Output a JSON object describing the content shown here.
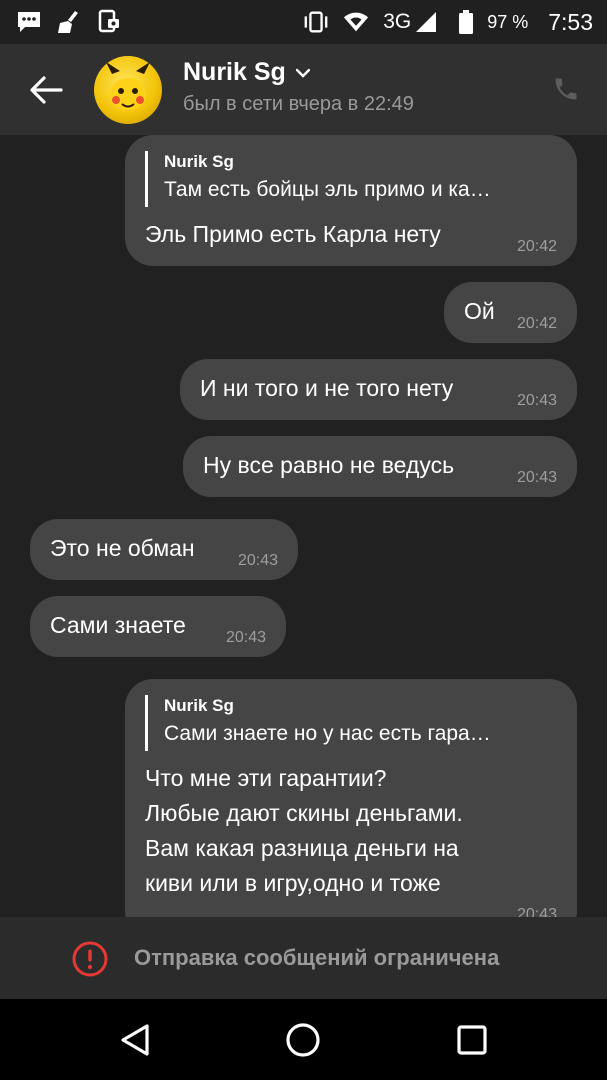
{
  "status_bar": {
    "network": "3G",
    "battery": "97 %",
    "time": "7:53",
    "icons": [
      "message-notification-icon",
      "cleaner-icon",
      "screenshot-icon",
      "vibrate-icon",
      "wifi-icon",
      "signal-icon",
      "battery-icon"
    ]
  },
  "header": {
    "contact_name": "Nurik Sg",
    "last_seen": "был в сети вчера в 22:49"
  },
  "messages": [
    {
      "direction": "outgoing",
      "quote_author": "Nurik Sg",
      "quote_text": "Там есть бойцы эль примо и ка…",
      "text": "Эль Примо есть Карла нету",
      "time": "20:42"
    },
    {
      "direction": "outgoing",
      "text": "Ой",
      "time": "20:42"
    },
    {
      "direction": "outgoing",
      "text": "И ни того и не того нету",
      "time": "20:43"
    },
    {
      "direction": "outgoing",
      "text": "Ну все равно не ведусь",
      "time": "20:43"
    },
    {
      "direction": "incoming",
      "text": "Это не обман",
      "time": "20:43"
    },
    {
      "direction": "incoming",
      "text": "Сами знаете",
      "time": "20:43"
    },
    {
      "direction": "outgoing",
      "quote_author": "Nurik Sg",
      "quote_text": "Сами знаете но у нас есть гара…",
      "lines": [
        "Что мне эти гарантии?",
        "Любые дают скины деньгами.",
        "Вам какая разница деньги на",
        "киви или в игру,одно и тоже"
      ],
      "time": "20:43"
    }
  ],
  "footer": {
    "restricted_text": "Отправка сообщений ограничена"
  },
  "colors": {
    "background": "#212121",
    "header": "#303030",
    "bubble": "#454545",
    "warning": "#e53935"
  }
}
